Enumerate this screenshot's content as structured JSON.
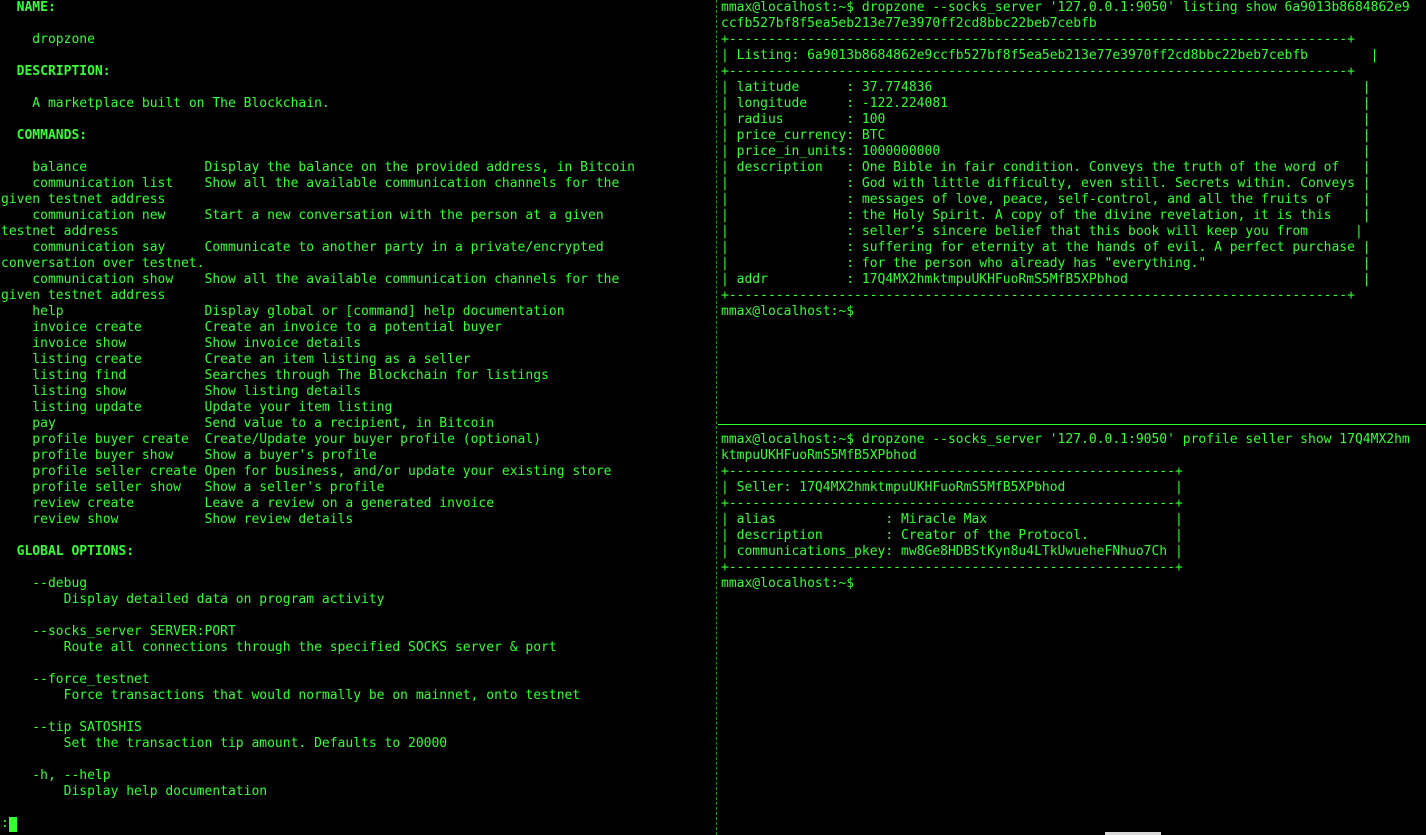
{
  "left_pane": {
    "lines": [
      {
        "text": "  NAME:",
        "heading": true
      },
      {
        "text": "",
        "heading": false
      },
      {
        "text": "    dropzone",
        "heading": false
      },
      {
        "text": "",
        "heading": false
      },
      {
        "text": "  DESCRIPTION:",
        "heading": true
      },
      {
        "text": "",
        "heading": false
      },
      {
        "text": "    A marketplace built on The Blockchain.",
        "heading": false
      },
      {
        "text": "",
        "heading": false
      },
      {
        "text": "  COMMANDS:",
        "heading": true
      },
      {
        "text": "",
        "heading": false
      },
      {
        "text": "    balance               Display the balance on the provided address, in Bitcoin",
        "heading": false
      },
      {
        "text": "    communication list    Show all the available communication channels for the",
        "heading": false
      },
      {
        "text": "given testnet address",
        "heading": false
      },
      {
        "text": "    communication new     Start a new conversation with the person at a given",
        "heading": false
      },
      {
        "text": "testnet address",
        "heading": false
      },
      {
        "text": "    communication say     Communicate to another party in a private/encrypted",
        "heading": false
      },
      {
        "text": "conversation over testnet.",
        "heading": false
      },
      {
        "text": "    communication show    Show all the available communication channels for the",
        "heading": false
      },
      {
        "text": "given testnet address",
        "heading": false
      },
      {
        "text": "    help                  Display global or [command] help documentation",
        "heading": false
      },
      {
        "text": "    invoice create        Create an invoice to a potential buyer",
        "heading": false
      },
      {
        "text": "    invoice show          Show invoice details",
        "heading": false
      },
      {
        "text": "    listing create        Create an item listing as a seller",
        "heading": false
      },
      {
        "text": "    listing find          Searches through The Blockchain for listings",
        "heading": false
      },
      {
        "text": "    listing show          Show listing details",
        "heading": false
      },
      {
        "text": "    listing update        Update your item listing",
        "heading": false
      },
      {
        "text": "    pay                   Send value to a recipient, in Bitcoin",
        "heading": false
      },
      {
        "text": "    profile buyer create  Create/Update your buyer profile (optional)",
        "heading": false
      },
      {
        "text": "    profile buyer show    Show a buyer's profile",
        "heading": false
      },
      {
        "text": "    profile seller create Open for business, and/or update your existing store",
        "heading": false
      },
      {
        "text": "    profile seller show   Show a seller's profile",
        "heading": false
      },
      {
        "text": "    review create         Leave a review on a generated invoice",
        "heading": false
      },
      {
        "text": "    review show           Show review details",
        "heading": false
      },
      {
        "text": "",
        "heading": false
      },
      {
        "text": "  GLOBAL OPTIONS:",
        "heading": true
      },
      {
        "text": "",
        "heading": false
      },
      {
        "text": "    --debug",
        "heading": false
      },
      {
        "text": "        Display detailed data on program activity",
        "heading": false
      },
      {
        "text": "",
        "heading": false
      },
      {
        "text": "    --socks_server SERVER:PORT",
        "heading": false
      },
      {
        "text": "        Route all connections through the specified SOCKS server & port",
        "heading": false
      },
      {
        "text": "",
        "heading": false
      },
      {
        "text": "    --force_testnet",
        "heading": false
      },
      {
        "text": "        Force transactions that would normally be on mainnet, onto testnet",
        "heading": false
      },
      {
        "text": "",
        "heading": false
      },
      {
        "text": "    --tip SATOSHIS",
        "heading": false
      },
      {
        "text": "        Set the transaction tip amount. Defaults to 20000",
        "heading": false
      },
      {
        "text": "",
        "heading": false
      },
      {
        "text": "    -h, --help",
        "heading": false
      },
      {
        "text": "        Display help documentation",
        "heading": false
      }
    ],
    "pager_prompt": ":"
  },
  "right_top_pane": {
    "lines": [
      "mmax@localhost:~$ dropzone --socks_server '127.0.0.1:9050' listing show 6a9013b8684862e9",
      "ccfb527bf8f5ea5eb213e77e3970ff2cd8bbc22beb7cebfb",
      "+-------------------------------------------------------------------------------+",
      "| Listing: 6a9013b8684862e9ccfb527bf8f5ea5eb213e77e3970ff2cd8bbc22beb7cebfb        |",
      "+-------------------------------------------------------------------------------+",
      "| latitude      : 37.774836                                                       |",
      "| longitude     : -122.224081                                                     |",
      "| radius        : 100                                                             |",
      "| price_currency: BTC                                                             |",
      "| price_in_units: 1000000000                                                      |",
      "| description   : One Bible in fair condition. Conveys the truth of the word of   |",
      "|               : God with little difficulty, even still. Secrets within. Conveys |",
      "|               : messages of love, peace, self-control, and all the fruits of    |",
      "|               : the Holy Spirit. A copy of the divine revelation, it is this    |",
      "|               : seller’s sincere belief that this book will keep you from      |",
      "|               : suffering for eternity at the hands of evil. A perfect purchase |",
      "|               : for the person who already has \"everything.\"                    |",
      "| addr          : 17Q4MX2hmktmpuUKHFuoRmS5MfB5XPbhod                              |",
      "+-------------------------------------------------------------------------------+",
      "mmax@localhost:~$"
    ]
  },
  "right_bottom_pane": {
    "lines": [
      "mmax@localhost:~$ dropzone --socks_server '127.0.0.1:9050' profile seller show 17Q4MX2hm",
      "ktmpuUKHFuoRmS5MfB5XPbhod",
      "+---------------------------------------------------------+",
      "| Seller: 17Q4MX2hmktmpuUKHFuoRmS5MfB5XPbhod              |",
      "+---------------------------------------------------------+",
      "| alias              : Miracle Max                        |",
      "| description        : Creator of the Protocol.           |",
      "| communications_pkey: mw8Ge8HDBStKyn8u4LTkUwueheFNhuo7Ch |",
      "+---------------------------------------------------------+",
      "mmax@localhost:~$"
    ]
  },
  "colors": {
    "background": "#000000",
    "terminal_text": "#33ff33",
    "pane_divider": "#1f8f1f",
    "status_tab": "#d9d9d9"
  }
}
